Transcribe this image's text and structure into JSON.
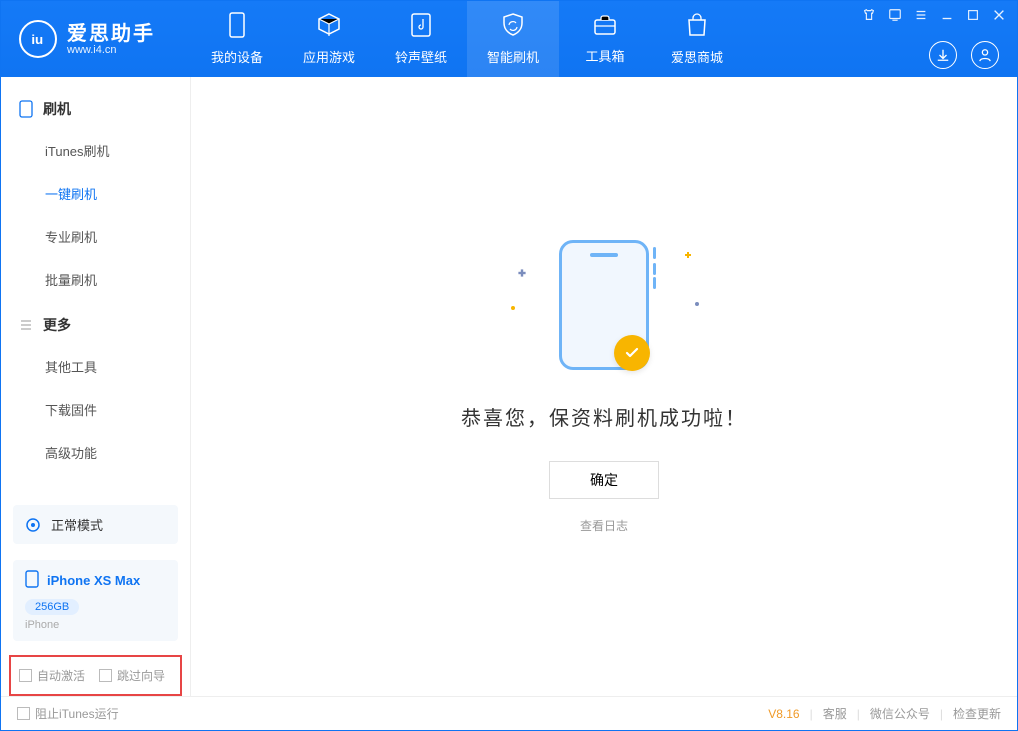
{
  "app": {
    "name": "爱思助手",
    "site": "www.i4.cn"
  },
  "nav": {
    "items": [
      {
        "label": "我的设备"
      },
      {
        "label": "应用游戏"
      },
      {
        "label": "铃声壁纸"
      },
      {
        "label": "智能刷机"
      },
      {
        "label": "工具箱"
      },
      {
        "label": "爱思商城"
      }
    ],
    "active_index": 3
  },
  "sidebar": {
    "groups": [
      {
        "title": "刷机",
        "items": [
          "iTunes刷机",
          "一键刷机",
          "专业刷机",
          "批量刷机"
        ],
        "active_index": 1
      },
      {
        "title": "更多",
        "items": [
          "其他工具",
          "下载固件",
          "高级功能"
        ],
        "active_index": -1
      }
    ],
    "mode_card": {
      "label": "正常模式"
    },
    "device": {
      "name": "iPhone XS Max",
      "storage": "256GB",
      "type": "iPhone"
    },
    "options": {
      "auto_activate": "自动激活",
      "skip_guide": "跳过向导"
    }
  },
  "main": {
    "success_title": "恭喜您，保资料刷机成功啦！",
    "ok_button": "确定",
    "view_log": "查看日志"
  },
  "status": {
    "block_itunes": "阻止iTunes运行",
    "version": "V8.16",
    "links": [
      "客服",
      "微信公众号",
      "检查更新"
    ]
  },
  "colors": {
    "primary": "#0f74f2",
    "accent": "#f8b500",
    "danger_border": "#e74545"
  }
}
